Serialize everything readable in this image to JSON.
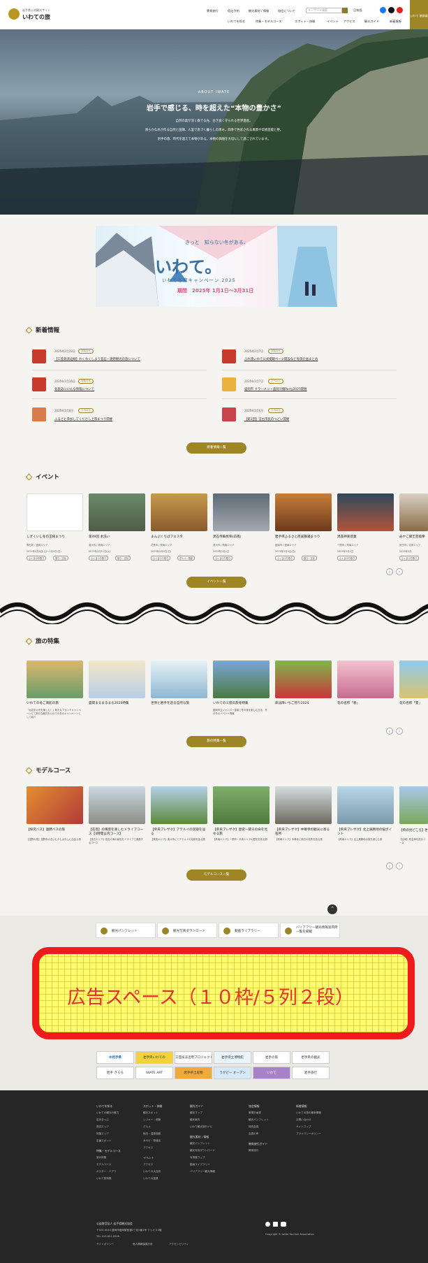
{
  "header": {
    "logo_sub": "岩手県公式観光サイト",
    "logo_main": "いわての旅",
    "nav_top": [
      "教育旅行",
      "宿泊予約",
      "観光素材 / 情報",
      "協会について"
    ],
    "search_placeholder": "キーワード検索",
    "lang_label": "日本語",
    "nav_bottom": [
      "いわてを知る",
      "特集・モデルコース",
      "スポット・体験",
      "イベント",
      "アクセス",
      "観光ガイド",
      "新着情報"
    ],
    "top_button": "いわて\n旅倶楽"
  },
  "hero": {
    "eyebrow": "ABOUT IWATE",
    "title": "岩手で感じる、時を超えた“本物の豊かさ”",
    "lines": [
      "自然の奥が深く奏でる光、古き良く守られる世界遺産。",
      "清らかな水が作る自然と田畑、人里で息づく暮らしの恵み。四季で色彩される風景や伝統芸能と祭。",
      "岩手の旅、時代を超えて本物がある。本物の価値を大切にして過ごされています。"
    ]
  },
  "campaign": {
    "pre": "きっと　知らない冬がある、",
    "title": "いわて。",
    "sub": "いわて冬旅キャンペーン 2025",
    "date": "期間　2025年 1月1日〜3月31日"
  },
  "news": {
    "heading": "新着情報",
    "items": [
      {
        "date": "2025年2月22日",
        "tag": "お知らせ",
        "title": "【三陸鉄道沿線】わくわくしよう釜石・遠野観光の旅について"
      },
      {
        "date": "2025年2月7日",
        "tag": "お知らせ",
        "title": "ふれ旅いわて公式掲載ページ開設など冬旅企画まとめ"
      },
      {
        "date": "2025年1月16日",
        "tag": "お知らせ",
        "title": "冬旅あにいんな情報について"
      },
      {
        "date": "2025年1月7日",
        "tag": "イベント",
        "title": "盛岡市 ＃ラーメン・盛岡冷麺Party2025開催"
      },
      {
        "date": "2025年1月8日",
        "tag": "イベント",
        "title": "ふるさと参加してくださし上祭まつり開催"
      },
      {
        "date": "2025年1月6日",
        "tag": "イベント",
        "title": "【第3回】宮古市民のつどい開催"
      }
    ],
    "more": "新着情報一覧"
  },
  "events": {
    "heading": "イベント",
    "cards": [
      {
        "title": "しずくいし冬の王様まつり",
        "meta": "雫石町 / 盛岡エリア",
        "date": "2025年2月8日(土)〜2月9日(日)",
        "tags": [
          "ふくまつり祭り",
          "祭り・文化"
        ]
      },
      {
        "title": "第49回 木洗い",
        "meta": "奥州市 / 県南エリア",
        "date": "2025年2月11日(火)",
        "tags": [
          "ふくまつり祭り",
          "祭り・文化"
        ]
      },
      {
        "title": "まんぶくりばフェスタ",
        "meta": "花巻市 / 県南エリア",
        "date": "2025年2月9日(日)",
        "tags": [
          "ふくまつり祭り",
          "グルメ・物産"
        ]
      },
      {
        "title": "黒石寺蘇民祭(前夜)",
        "meta": "奥州市 / 県南エリア",
        "date": "2025年2月1日",
        "tags": [
          "ふくまつり祭り"
        ]
      },
      {
        "title": "岩手県ふるさと民謡舞踊まつり",
        "meta": "盛岡市 / 盛岡エリア",
        "date": "2025年2月9日(日)",
        "tags": [
          "ふくまつり祭り",
          "祭り・文化"
        ]
      },
      {
        "title": "黒森神楽巡業",
        "meta": "一関市 / 県南エリア",
        "date": "2025年2月1日",
        "tags": [
          "ふくまつり祭り"
        ]
      },
      {
        "title": "みやこ郷土芸能祭",
        "meta": "宮古市 / 沿岸エリア",
        "date": "2025年2月",
        "tags": [
          "ふくまつり祭り"
        ]
      }
    ],
    "more": "イベント一覧"
  },
  "features": {
    "heading": "旅の特集",
    "cards": [
      {
        "title": "いわての冬ご来館の旅",
        "desc": "「北岩手の冬を楽しむ！」新たなブランドキャンペーンにて新たな魅力をいわての冬のキャンペーンとして紹介"
      },
      {
        "title": "盛岡まるまるまる2025特集",
        "desc": ""
      },
      {
        "title": "世界と岩手を巡る自然な旅",
        "desc": ""
      },
      {
        "title": "いわての三陸の旅冬特集",
        "desc": "盛岡市立ジャンパー温泉と冬の旅を楽しむ方法、冬の冬のイベント情報"
      },
      {
        "title": "床は降いちご狩り2024",
        "desc": ""
      },
      {
        "title": "花の名所「春」",
        "desc": ""
      },
      {
        "title": "花の名所「夏」",
        "desc": ""
      }
    ],
    "more": "旅の特集一覧"
  },
  "courses": {
    "heading": "モデルコース",
    "cards": [
      {
        "title": "【探究バス】遠野バスの旅",
        "desc": "【遠野の旅】遠野市の古いむかしばなしに出会う旅"
      },
      {
        "title": "【花巻】の風景を楽しむドライブコース【4時間以内コース】",
        "desc": "【宮古エリア】宮古の海の景色をドライブで満喫するコース"
      },
      {
        "title": "【県央ブレザク】アテルイの足跡を辿る",
        "desc": "【県央エリア】奥州市にてアテルイの足跡を辿る旅"
      },
      {
        "title": "【県央ブレザク】歴史一関その命を見ゆる旅",
        "desc": "【県南エリア】一関市・平泉エリアの歴史を巡る旅"
      },
      {
        "title": "【県央ブレザク】中尊寺の観光に寄る名所",
        "desc": "【県南エリア】中尊寺と周辺の名所を巡る旅"
      },
      {
        "title": "【県央ブレザク】北上展勝地の桜ポイント",
        "desc": "【県南エリア】北上展勝地の桜を楽しむ旅"
      },
      {
        "title": "【県の見どころ】岩手縦断",
        "desc": "【全域】県全体を巡るコース"
      }
    ],
    "more": "モデルコース一覧"
  },
  "links": [
    "観光パンフレット",
    "観光写真ダウンロード",
    "動画ライブラリー",
    "バリアフリー観光情報案内所一覧を掲載"
  ],
  "ad_text": "広告スペース（１０枠/５列２段）",
  "partners": [
    "ゆ岩手県",
    "岩手県いわての",
    "工芸技法活用プロジェクト",
    "岩手県立博物館",
    "岩手の旅",
    "岩手県の観光",
    "岩手 きらら",
    "IWATE ART",
    "岩手県土産物",
    "ラグビー オープン",
    "いわて",
    "岩手旅行"
  ],
  "footer": {
    "col1": {
      "head": "いわてを知る",
      "items": [
        "いわての観光の魅力",
        "岩手まっぷ",
        "周辺エリア",
        "特集エリア",
        "定番スポット"
      ],
      "head2": "特集・モデルコース",
      "items2": [
        "旅の特集",
        "モデルコース",
        "ポスター・エアワ",
        "いわて旅特集"
      ]
    },
    "col2": {
      "head": "スポット・体験",
      "items": [
        "観光スポット",
        "レジャー・体験",
        "グルメ",
        "宿泊・温泉旅館",
        "みやげ・物産品",
        "アクセス"
      ],
      "head2": "イベント",
      "items2": [
        "アクセス",
        "いわての大自然",
        "いわての温泉"
      ]
    },
    "col3": {
      "head": "観光ガイド",
      "items": [
        "観光マップ",
        "観光案内",
        "いわて観光旅行ナビ"
      ],
      "head2": "観光素材 / 情報",
      "items2": [
        "観光パンフレット",
        "観光写真ダウンロード",
        "写真館ウェブ",
        "動画ライブラリー",
        "バリアフリー観光情報"
      ]
    },
    "col4": {
      "head": "協会情報",
      "items": [
        "事業計画書",
        "観光パンフレット",
        "特別会員",
        "会員の声"
      ],
      "head2": "教育旅行ガイド",
      "items2": [
        "教育旅行"
      ]
    },
    "col5": {
      "head": "新着情報",
      "items": [
        "いわての旅の最新情報",
        "お問い合わせ",
        "サイトマップ",
        "プライバシーポリシー"
      ]
    },
    "org": "公益財団法人 岩手県観光協会",
    "address": "〒020-0045 盛岡市盛岡駅西通2丁目9番1号 マリオス3階",
    "tel": "TEL 019-651-0626",
    "copyright": "Copyright © Iwate Tourism Association",
    "bottom_links": [
      "サイトポリシー",
      "個人情報保護方針",
      "アクセシビリティ"
    ]
  },
  "colors": {
    "accent": "#9e8526",
    "ad_border": "#ee1b1b",
    "ad_fill": "#fffb70",
    "footer_bg": "#262626"
  }
}
